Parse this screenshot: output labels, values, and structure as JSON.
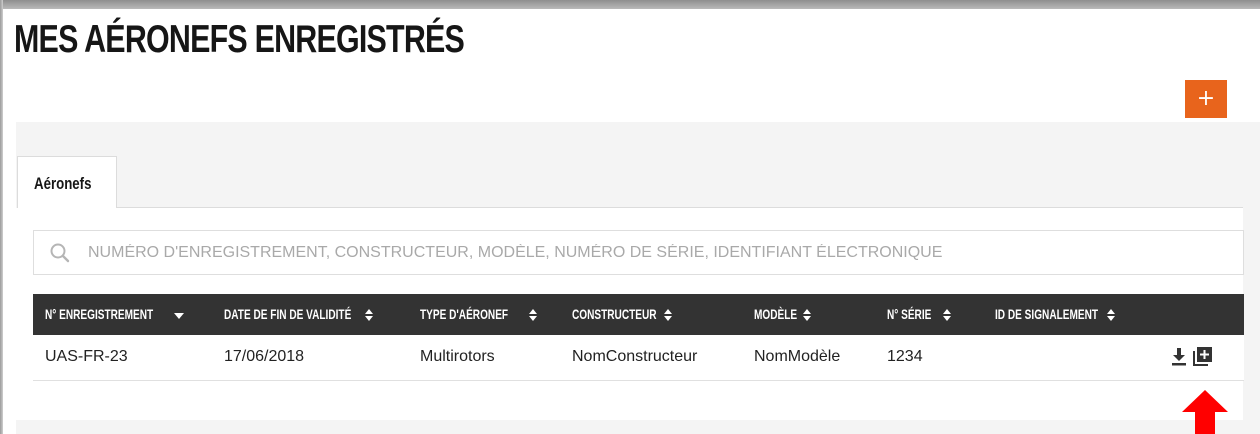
{
  "page": {
    "title": "MES AÉRONEFS ENREGISTRÉS",
    "add_button_label": "+"
  },
  "tabs": [
    {
      "label": "Aéronefs",
      "active": true
    }
  ],
  "search": {
    "placeholder": "NUMÉRO D'ENREGISTREMENT, CONSTRUCTEUR, MODÈLE, NUMÉRO DE SÉRIE, IDENTIFIANT ÉLECTRONIQUE",
    "value": "",
    "icon": "search-icon"
  },
  "table": {
    "columns": [
      {
        "label": "N° ENREGISTREMENT",
        "sort": "desc"
      },
      {
        "label": "DATE DE FIN DE VALIDITÉ",
        "sort": "none"
      },
      {
        "label": "TYPE D'AÉRONEF",
        "sort": "none"
      },
      {
        "label": "CONSTRUCTEUR",
        "sort": "none"
      },
      {
        "label": "MODÈLE",
        "sort": "none"
      },
      {
        "label": "N° SÉRIE",
        "sort": "none"
      },
      {
        "label": "ID DE SIGNALEMENT",
        "sort": "none"
      }
    ],
    "rows": [
      {
        "cells": [
          "UAS-FR-23",
          "17/06/2018",
          "Multirotors",
          "NomConstructeur",
          "NomModèle",
          "1234",
          ""
        ],
        "actions": [
          "download-icon",
          "add-document-icon"
        ]
      }
    ]
  },
  "colors": {
    "accent": "#e8641c",
    "header_bg": "#333333",
    "panel_bg": "#f4f4f4",
    "annotation_arrow": "#ff0000"
  }
}
